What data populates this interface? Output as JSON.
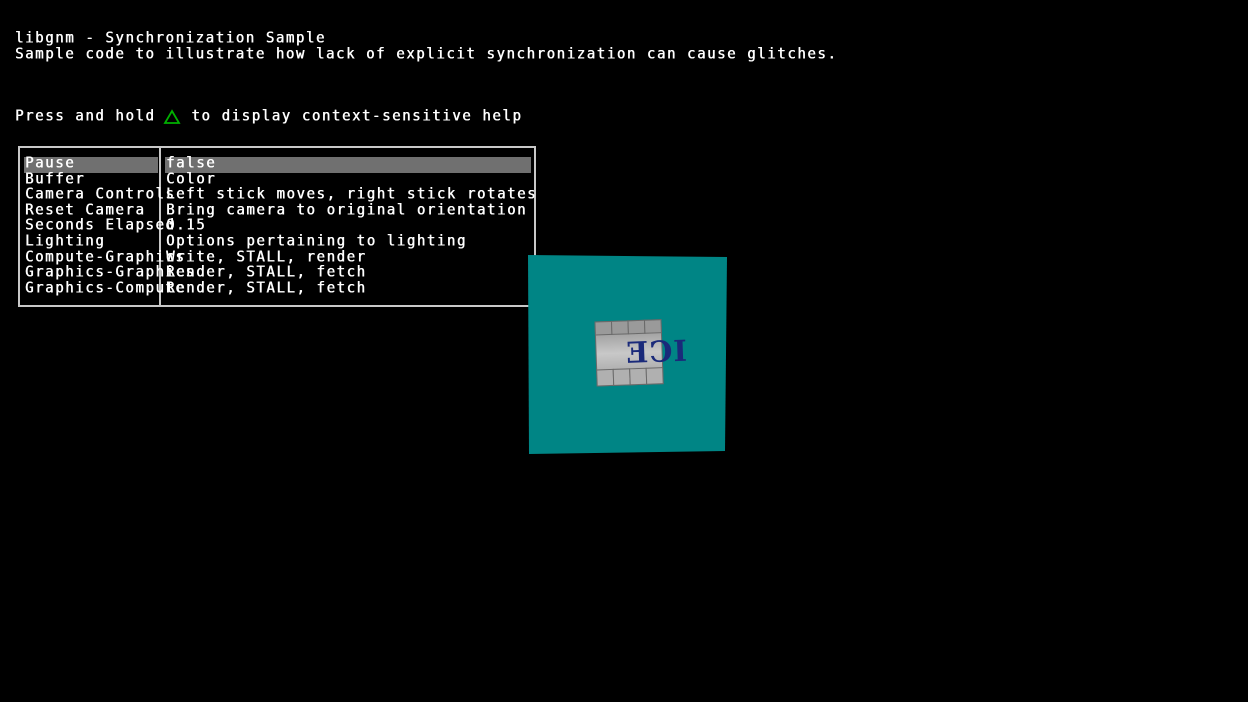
{
  "header": {
    "title": "libgnm - Synchronization Sample",
    "subtitle": "Sample code to illustrate how lack of explicit synchronization can cause glitches."
  },
  "help": {
    "prefix": "Press and hold",
    "button_icon": "triangle-icon",
    "button_color": "#00b000",
    "suffix": "to display context-sensitive help"
  },
  "menu": {
    "selected_index": 0,
    "items": [
      {
        "name": "Pause",
        "value": "false"
      },
      {
        "name": "Buffer",
        "value": "Color"
      },
      {
        "name": "Camera Controls",
        "value": "Left stick moves, right stick rotates"
      },
      {
        "name": "Reset Camera",
        "value": "Bring camera to original orientation"
      },
      {
        "name": "Seconds Elapsed",
        "value": "0.15"
      },
      {
        "name": "Lighting",
        "value": "Options pertaining to lighting"
      },
      {
        "name": "Compute-Graphics",
        "value": "Write, STALL, render"
      },
      {
        "name": "Graphics-Graphics",
        "value": "Render, STALL, fetch"
      },
      {
        "name": "Graphics-Compute",
        "value": "Render, STALL, fetch"
      }
    ]
  },
  "scene": {
    "quad_color": "#008585",
    "texture_label": "ICE",
    "texture_text_color": "#1a2a7a"
  }
}
